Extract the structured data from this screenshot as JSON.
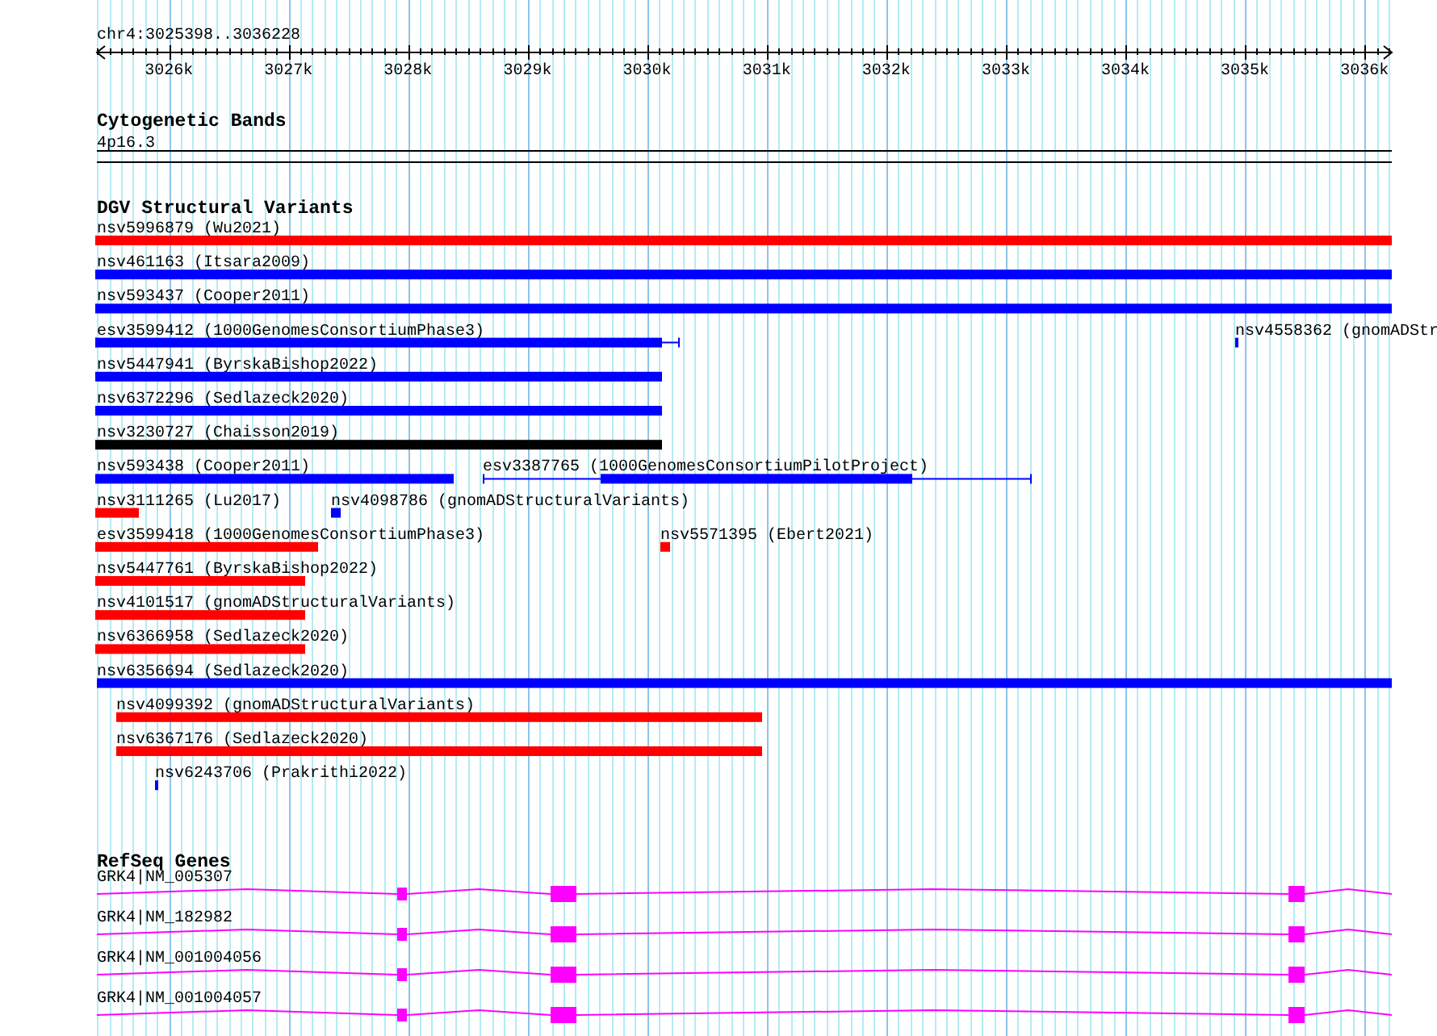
{
  "ruler": {
    "region": "chr4:3025398..3036228",
    "ticks": [
      "3026k",
      "3027k",
      "3028k",
      "3029k",
      "3030k",
      "3031k",
      "3032k",
      "3033k",
      "3034k",
      "3035k",
      "3036k"
    ]
  },
  "tracks": [
    {
      "title": "Cytogenetic Bands",
      "kind": "cytoband",
      "features": [
        {
          "label": "4p16.3"
        }
      ]
    },
    {
      "title": "DGV Structural Variants",
      "kind": "variants",
      "features": [
        {
          "label": "nsv5996879 (Wu2021)",
          "color": "#ff0000",
          "kind": "block"
        },
        {
          "label": "nsv461163 (Itsara2009)",
          "color": "#0000ff",
          "kind": "block"
        },
        {
          "label": "nsv593437 (Cooper2011)",
          "color": "#0000ff",
          "kind": "block"
        },
        {
          "label": "esv3599412 (1000GenomesConsortiumPhase3)",
          "color": "#0000ff",
          "kind": "spanned"
        },
        {
          "label": "nsv4558362 (gnomADStr",
          "color": "#0000ff",
          "kind": "block"
        },
        {
          "label": "nsv5447941 (ByrskaBishop2022)",
          "color": "#0000ff",
          "kind": "block"
        },
        {
          "label": "nsv6372296 (Sedlazeck2020)",
          "color": "#0000ff",
          "kind": "block"
        },
        {
          "label": "nsv3230727 (Chaisson2019)",
          "color": "#000000",
          "kind": "block"
        },
        {
          "label": "nsv593438 (Cooper2011)",
          "color": "#0000ff",
          "kind": "block"
        },
        {
          "label": "esv3387765 (1000GenomesConsortiumPilotProject)",
          "color": "#0000ff",
          "kind": "spanned"
        },
        {
          "label": "nsv3111265 (Lu2017)",
          "color": "#ff0000",
          "kind": "block"
        },
        {
          "label": "nsv4098786 (gnomADStructuralVariants)",
          "color": "#0000ff",
          "kind": "block"
        },
        {
          "label": "esv3599418 (1000GenomesConsortiumPhase3)",
          "color": "#ff0000",
          "kind": "block"
        },
        {
          "label": "nsv5571395 (Ebert2021)",
          "color": "#ff0000",
          "kind": "block"
        },
        {
          "label": "nsv5447761 (ByrskaBishop2022)",
          "color": "#ff0000",
          "kind": "block"
        },
        {
          "label": "nsv4101517 (gnomADStructuralVariants)",
          "color": "#ff0000",
          "kind": "block"
        },
        {
          "label": "nsv6366958 (Sedlazeck2020)",
          "color": "#ff0000",
          "kind": "block"
        },
        {
          "label": "nsv6356694 (Sedlazeck2020)",
          "color": "#0000ff",
          "kind": "block"
        },
        {
          "label": "nsv4099392 (gnomADStructuralVariants)",
          "color": "#ff0000",
          "kind": "block"
        },
        {
          "label": "nsv6367176 (Sedlazeck2020)",
          "color": "#ff0000",
          "kind": "block"
        },
        {
          "label": "nsv6243706 (Prakrithi2022)",
          "color": "#0000ff",
          "kind": "block"
        }
      ]
    },
    {
      "title": "RefSeq Genes",
      "kind": "genes",
      "features": [
        {
          "label": "GRK4|NM_005307"
        },
        {
          "label": "GRK4|NM_182982"
        },
        {
          "label": "GRK4|NM_001004056"
        },
        {
          "label": "GRK4|NM_001004057"
        }
      ]
    }
  ]
}
